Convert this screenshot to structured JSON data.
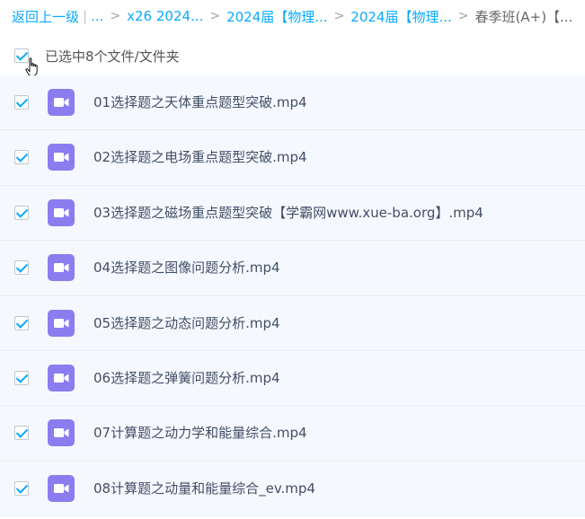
{
  "breadcrumb": {
    "back": "返回上一级",
    "separator": "|",
    "ellipsis": "...",
    "chevron": ">",
    "items": [
      "x26 2024...",
      "2024届【物理...",
      "2024届【物理..."
    ],
    "current": "春季班(A+)【..."
  },
  "selection": {
    "text": "已选中8个文件/文件夹",
    "checked": true
  },
  "files": [
    {
      "name": "01选择题之天体重点题型突破.mp4",
      "icon": "video-file-icon",
      "checked": true
    },
    {
      "name": "02选择题之电场重点题型突破.mp4",
      "icon": "video-file-icon",
      "checked": true
    },
    {
      "name": "03选择题之磁场重点题型突破【学霸网www.xue-ba.org】.mp4",
      "icon": "video-file-icon",
      "checked": true
    },
    {
      "name": "04选择题之图像问题分析.mp4",
      "icon": "video-file-icon",
      "checked": true
    },
    {
      "name": "05选择题之动态问题分析.mp4",
      "icon": "video-file-icon",
      "checked": true
    },
    {
      "name": "06选择题之弹簧问题分析.mp4",
      "icon": "video-file-icon",
      "checked": true
    },
    {
      "name": "07计算题之动力学和能量综合.mp4",
      "icon": "video-file-icon",
      "checked": true
    },
    {
      "name": "08计算题之动量和能量综合_ev.mp4",
      "icon": "video-file-icon",
      "checked": true
    }
  ],
  "colors": {
    "accent": "#09aaff",
    "row_background": "#f5f9ff",
    "video_icon": "#8c7cf0"
  }
}
